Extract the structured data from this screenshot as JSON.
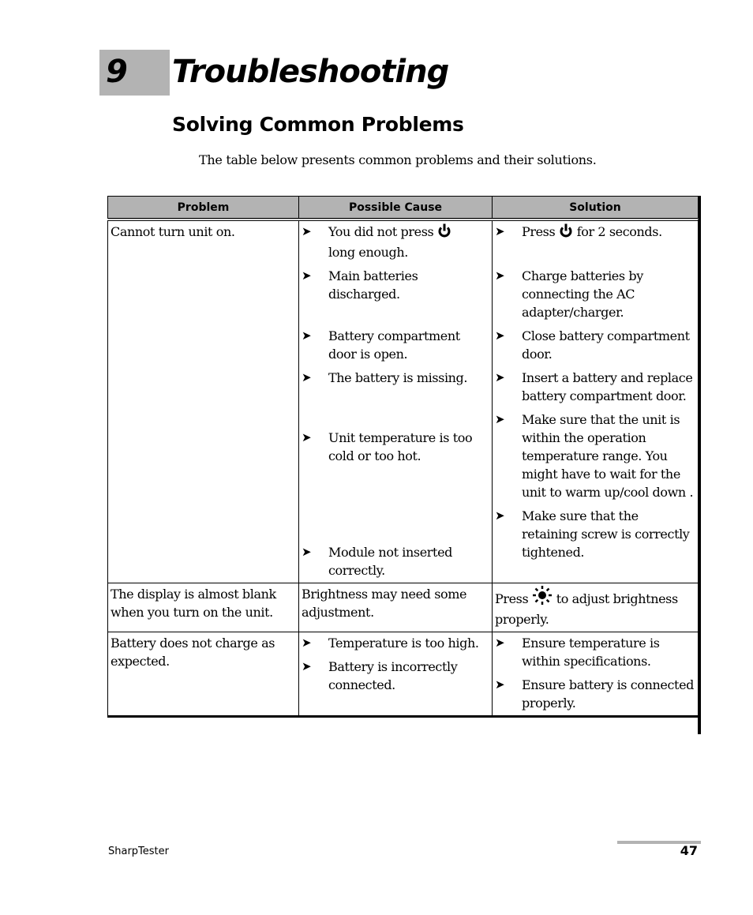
{
  "chapter": {
    "number": "9",
    "title": "Troubleshooting"
  },
  "section": {
    "title": "Solving Common Problems"
  },
  "intro": "The table below presents common problems and their solutions.",
  "table": {
    "headers": [
      "Problem",
      "Possible Cause",
      "Solution"
    ],
    "rows": [
      {
        "problem": "Cannot turn unit on.",
        "pairs": [
          {
            "cause_a": "You did not press",
            "cause_icon": "power-icon",
            "cause_b": "long enough.",
            "solution_a": "Press",
            "solution_icon": "power-icon",
            "solution_b": "for 2 seconds."
          },
          {
            "cause": "Main batteries discharged.",
            "solution": "Charge batteries by connecting the AC adapter/charger."
          },
          {
            "cause": "Battery compartment door is open.",
            "solution": "Close battery compartment door."
          },
          {
            "cause": "The battery is missing.",
            "solution": "Insert a battery and replace battery compartment door."
          },
          {
            "cause": "Unit temperature is too cold or too hot.",
            "solution": "Make sure that the unit is within the operation temperature range. You might have to wait for the unit to warm up/cool down ."
          },
          {
            "cause": "Module not inserted correctly.",
            "solution": "Make sure that the retaining screw is correctly tightened."
          }
        ]
      },
      {
        "problem": "The display is almost blank when you turn on the unit.",
        "cause": "Brightness may need some adjustment.",
        "solution_a": "Press",
        "solution_icon": "brightness-icon",
        "solution_b": "to adjust brightness properly."
      },
      {
        "problem": "Battery does not charge as expected.",
        "pairs": [
          {
            "cause": "Temperature is too high.",
            "solution": "Ensure temperature is within specifications."
          },
          {
            "cause": "Battery is incorrectly connected.",
            "solution": "Ensure battery is connected properly."
          }
        ]
      }
    ],
    "bullet_glyph": "➤"
  },
  "footer": {
    "product": "SharpTester",
    "page_number": "47"
  }
}
